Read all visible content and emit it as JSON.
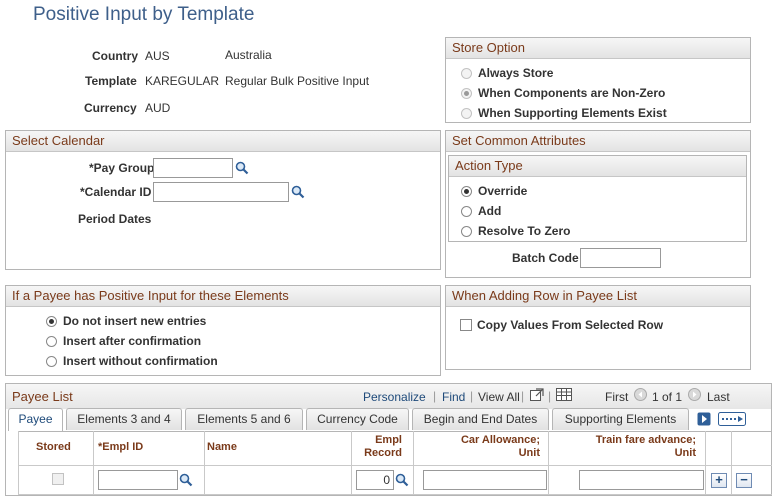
{
  "page": {
    "title": "Positive Input by Template"
  },
  "header_info": {
    "country_label": "Country",
    "country_code": "AUS",
    "country_name": "Australia",
    "template_label": "Template",
    "template_code": "KAREGULAR",
    "template_name": "Regular Bulk Positive Input",
    "currency_label": "Currency",
    "currency_code": "AUD"
  },
  "store_option": {
    "title": "Store Option",
    "options": [
      {
        "label": "Always Store",
        "selected": false
      },
      {
        "label": "When Components are Non-Zero",
        "selected": true
      },
      {
        "label": "When Supporting Elements Exist",
        "selected": false
      }
    ]
  },
  "select_calendar": {
    "title": "Select Calendar",
    "pay_group_label": "*Pay Group",
    "pay_group_value": "",
    "calendar_id_label": "*Calendar ID",
    "calendar_id_value": "",
    "period_dates_label": "Period Dates"
  },
  "common_attributes": {
    "title": "Set Common Attributes",
    "action_type_title": "Action Type",
    "options": [
      {
        "label": "Override",
        "selected": true
      },
      {
        "label": "Add",
        "selected": false
      },
      {
        "label": "Resolve To Zero",
        "selected": false
      }
    ],
    "batch_code_label": "Batch Code",
    "batch_code_value": ""
  },
  "payee_positive_input": {
    "title": "If a Payee has Positive Input for these Elements",
    "options": [
      {
        "label": "Do not insert new entries",
        "selected": true
      },
      {
        "label": "Insert after confirmation",
        "selected": false
      },
      {
        "label": "Insert without confirmation",
        "selected": false
      }
    ]
  },
  "adding_row": {
    "title": "When Adding Row in Payee List",
    "copy_label": "Copy Values From Selected Row"
  },
  "payee_list": {
    "title": "Payee List",
    "personalize": "Personalize",
    "find": "Find",
    "view_all": "View All",
    "first": "First",
    "range": "1 of 1",
    "last": "Last",
    "tabs": [
      "Payee",
      "Elements 3 and 4",
      "Elements 5 and 6",
      "Currency Code",
      "Begin and End Dates",
      "Supporting Elements"
    ],
    "columns": {
      "stored": "Stored",
      "empl_id": "*Empl ID",
      "name": "Name",
      "empl_record_1": "Empl",
      "empl_record_2": "Record",
      "car_allowance_1": "Car Allowance;",
      "car_allowance_2": "Unit",
      "train_fare_1": "Train fare advance;",
      "train_fare_2": "Unit"
    },
    "row": {
      "empl_id": "",
      "empl_record": "0",
      "car_allowance": "",
      "train_fare": ""
    }
  },
  "colors": {
    "title": "#3e5f8a",
    "group_header": "#7a3a1a",
    "link": "#1e4a7a"
  }
}
